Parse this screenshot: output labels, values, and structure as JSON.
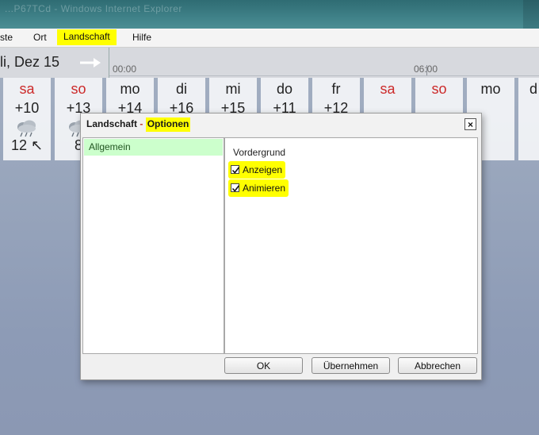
{
  "window": {
    "title": "...P67TCd - Windows Internet Explorer"
  },
  "menu": {
    "items": [
      "ste",
      "Ort",
      "Landschaft",
      "Hilfe"
    ]
  },
  "datebar": {
    "date": "li, Dez 15",
    "ticks": [
      "00:00",
      "06:00"
    ]
  },
  "days": [
    {
      "name": "sa",
      "weekend": true,
      "temp": "+10",
      "icon": "rain-cloud-icon",
      "wind": "12 ↖"
    },
    {
      "name": "so",
      "weekend": true,
      "temp": "+13",
      "icon": "rain-cloud-icon",
      "wind": "8"
    },
    {
      "name": "mo",
      "weekend": false,
      "temp": "+14",
      "icon": "",
      "wind": ""
    },
    {
      "name": "di",
      "weekend": false,
      "temp": "+16",
      "icon": "",
      "wind": ""
    },
    {
      "name": "mi",
      "weekend": false,
      "temp": "+15",
      "icon": "",
      "wind": ""
    },
    {
      "name": "do",
      "weekend": false,
      "temp": "+11",
      "icon": "",
      "wind": ""
    },
    {
      "name": "fr",
      "weekend": false,
      "temp": "+12",
      "icon": "",
      "wind": ""
    },
    {
      "name": "sa",
      "weekend": true,
      "temp": "",
      "icon": "",
      "wind": ""
    },
    {
      "name": "so",
      "weekend": true,
      "temp": "",
      "icon": "",
      "wind": ""
    },
    {
      "name": "mo",
      "weekend": false,
      "temp": "",
      "icon": "",
      "wind": ""
    },
    {
      "name": "d",
      "weekend": false,
      "temp": "",
      "icon": "",
      "wind": ""
    }
  ],
  "dialog": {
    "title_main": "Landschaft",
    "title_sep": " - ",
    "title_sub": "Optionen",
    "close_label": "×",
    "categories": [
      "Allgemein"
    ],
    "group_label": "Vordergrund",
    "options": [
      {
        "label": "Anzeigen",
        "checked": true
      },
      {
        "label": "Animieren",
        "checked": true
      }
    ],
    "buttons": {
      "ok": "OK",
      "apply": "Übernehmen",
      "cancel": "Abbrechen"
    }
  },
  "colors": {
    "highlight": "#ffff00",
    "weekend": "#cc2a2a",
    "category_selected_bg": "#ccffcc"
  }
}
